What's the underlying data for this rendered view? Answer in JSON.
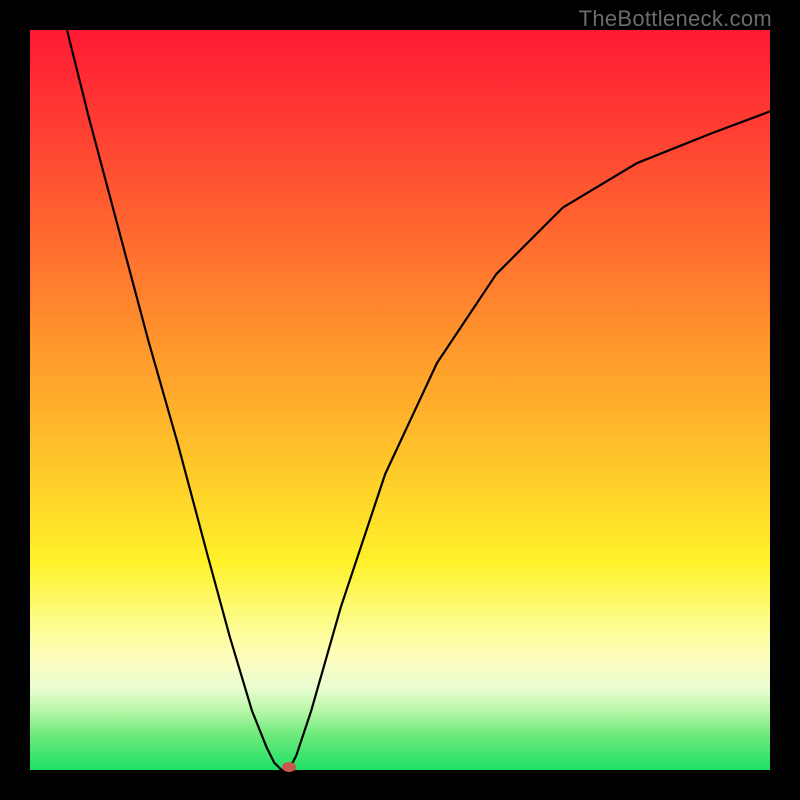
{
  "watermark": "TheBottleneck.com",
  "chart_data": {
    "type": "line",
    "title": "",
    "xlabel": "",
    "ylabel": "",
    "xlim": [
      0,
      100
    ],
    "ylim": [
      0,
      100
    ],
    "grid": false,
    "legend": false,
    "series": [
      {
        "name": "curve",
        "x": [
          5,
          8,
          12,
          16,
          20,
          24,
          27,
          30,
          32,
          33,
          34,
          35,
          36,
          38,
          42,
          48,
          55,
          63,
          72,
          82,
          92,
          100
        ],
        "values": [
          100,
          88,
          73,
          58,
          44,
          29,
          18,
          8,
          3,
          1,
          0,
          0,
          2,
          8,
          22,
          40,
          55,
          67,
          76,
          82,
          86,
          89
        ]
      }
    ],
    "marker": {
      "x": 35,
      "y": 0,
      "color": "#c8584e"
    },
    "background_gradient": {
      "direction": "top-to-bottom",
      "stops": [
        {
          "pos": 0.0,
          "color": "#ff1a33"
        },
        {
          "pos": 0.28,
          "color": "#ff6a2f"
        },
        {
          "pos": 0.52,
          "color": "#ffb22b"
        },
        {
          "pos": 0.72,
          "color": "#fff12a"
        },
        {
          "pos": 0.85,
          "color": "#fdfdc0"
        },
        {
          "pos": 1.0,
          "color": "#1ee066"
        }
      ]
    }
  }
}
